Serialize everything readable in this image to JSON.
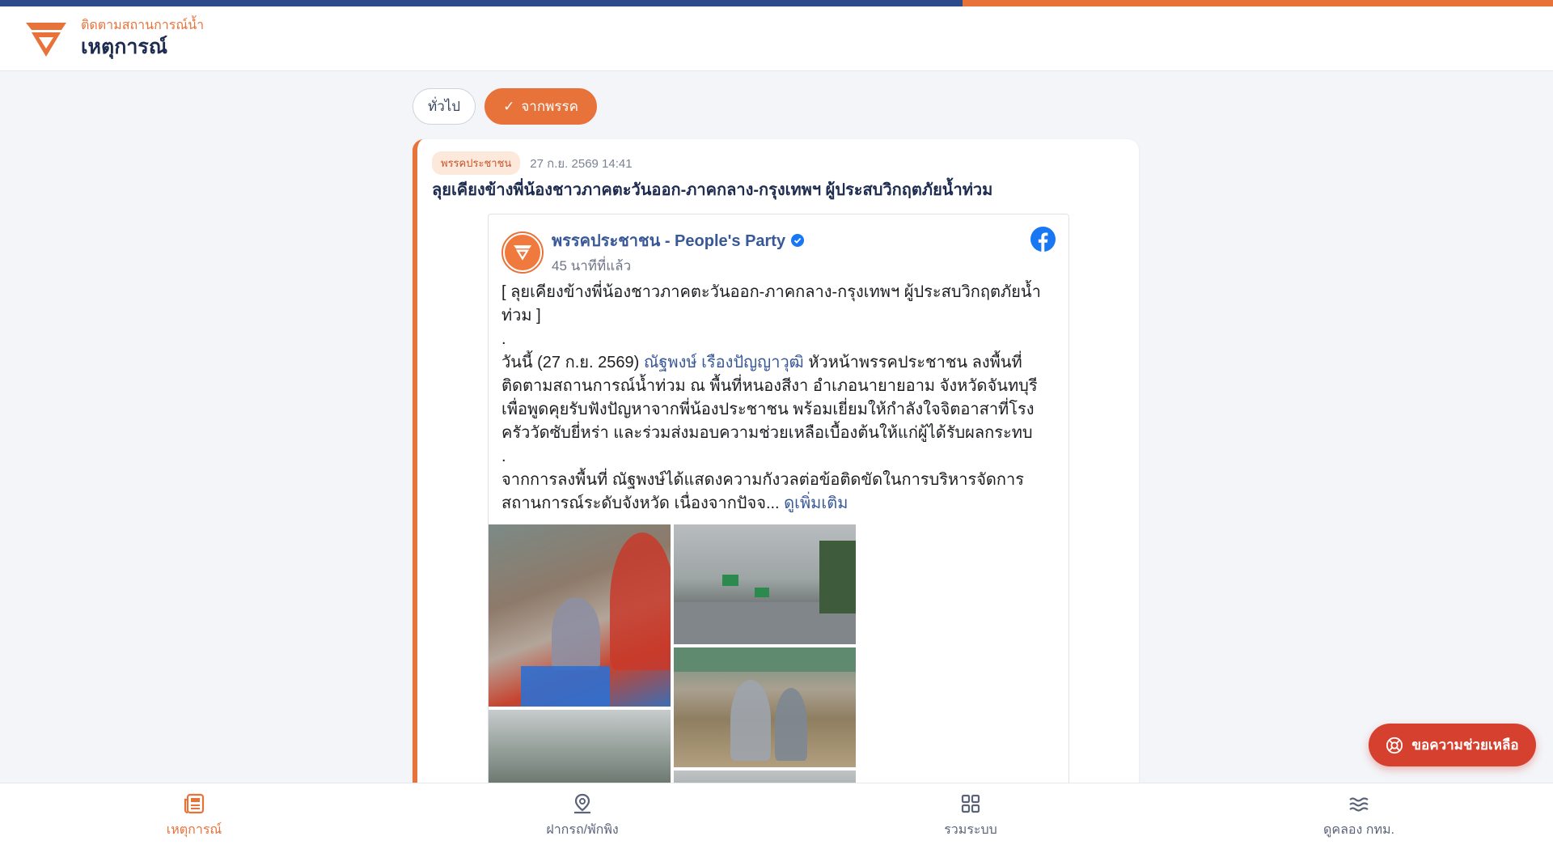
{
  "colors": {
    "accent": "#e8733a",
    "navy": "#2c4a8c",
    "help": "#d6402f",
    "fb_link": "#385898"
  },
  "header": {
    "subtitle": "ติดตามสถานการณ์น้ำ",
    "title": "เหตุการณ์",
    "logo_icon": "party-logo-icon"
  },
  "filters": {
    "general": "ทั่วไป",
    "from_party_check": "✓",
    "from_party": "จากพรรค"
  },
  "post": {
    "tag": "พรรคประชาชน",
    "timestamp": "27 ก.ย. 2569 14:41",
    "title": "ลุยเคียงข้างพี่น้องชาวภาคตะวันออก-ภาคกลาง-กรุงเทพฯ ผู้ประสบวิกฤตภัยน้ำท่วม"
  },
  "fb_post": {
    "page_name": "พรรคประชาชน - People's Party",
    "time_ago": "45 นาทีที่แล้ว",
    "line1": "[ ลุยเคียงข้างพี่น้องชาวภาคตะวันออก-ภาคกลาง-กรุงเทพฯ ผู้ประสบวิกฤตภัยน้ำท่วม ]",
    "dot1": ".",
    "p2_before": "วันนี้ (27 ก.ย. 2569) ",
    "p2_link": "ณัฐพงษ์ เรืองปัญญาวุฒิ",
    "p2_after": " หัวหน้าพรรคประชาชน ลงพื้นที่ติดตามสถานการณ์น้ำท่วม ณ พื้นที่หนองสีงา อำเภอนายายอาม จังหวัดจันทบุรี เพื่อพูดคุยรับฟังปัญหาจากพี่น้องประชาชน พร้อมเยี่ยมให้กำลังใจจิตอาสาที่โรงครัววัดซับยี่หร่า และร่วมส่งมอบความช่วยเหลือเบื้องต้นให้แก่ผู้ได้รับผลกระทบ",
    "dot2": ".",
    "p3": "จากการลงพื้นที่ ณัฐพงษ์ได้แสดงความกังวลต่อข้อติดขัดในการบริหารจัดการสถานการณ์ระดับจังหวัด เนื่องจากปัจจ... ",
    "see_more": "ดูเพิ่มเติม"
  },
  "help_button": "ขอความช่วยเหลือ",
  "bottom_nav": [
    {
      "label": "เหตุการณ์",
      "icon": "newspaper-icon",
      "active": true
    },
    {
      "label": "ฝากรถ/พักพิง",
      "icon": "map-pin-icon",
      "active": false
    },
    {
      "label": "รวมระบบ",
      "icon": "grid-icon",
      "active": false
    },
    {
      "label": "ดูคลอง กทม.",
      "icon": "waves-icon",
      "active": false
    }
  ]
}
